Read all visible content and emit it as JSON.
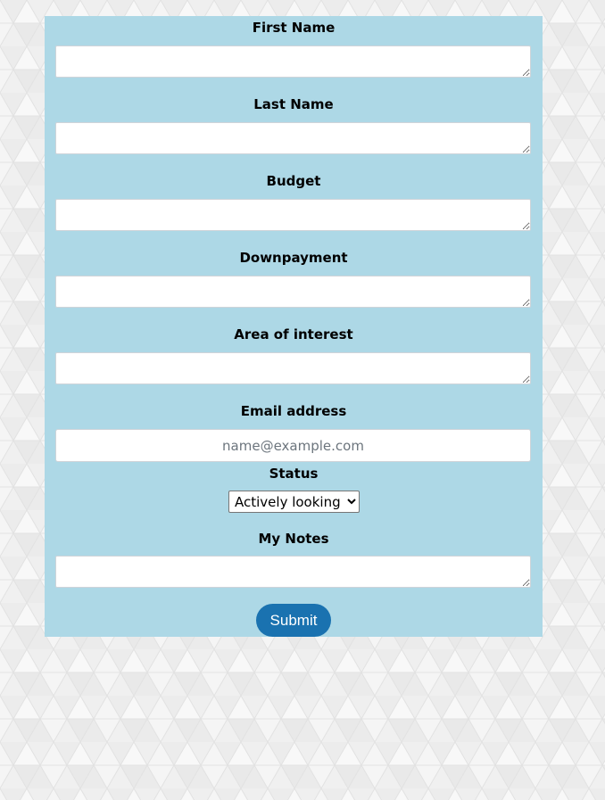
{
  "form": {
    "fields": [
      {
        "label": "First Name",
        "value": ""
      },
      {
        "label": "Last Name",
        "value": ""
      },
      {
        "label": "Budget",
        "value": ""
      },
      {
        "label": "Downpayment",
        "value": ""
      },
      {
        "label": "Area of interest",
        "value": ""
      }
    ],
    "email": {
      "label": "Email address",
      "placeholder": "name@example.com",
      "value": ""
    },
    "status": {
      "label": "Status",
      "selected": "Actively looking"
    },
    "notes": {
      "label": "My Notes",
      "value": ""
    },
    "submit_label": "Submit"
  },
  "colors": {
    "panel_background": "#add8e6",
    "submit_button": "#1a72b0",
    "page_background": "#f4f4f4"
  }
}
